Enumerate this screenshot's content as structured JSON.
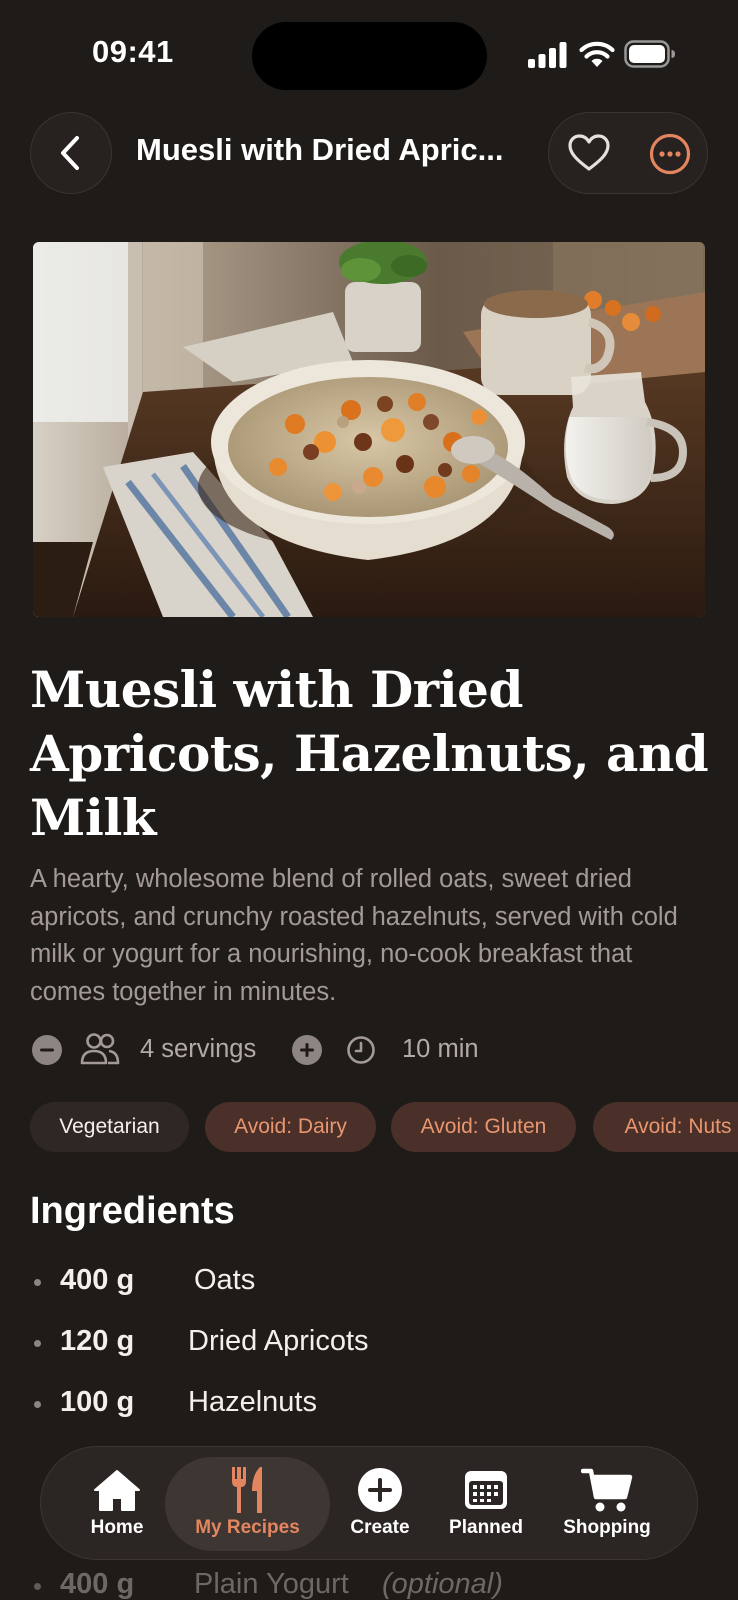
{
  "status_bar": {
    "time": "09:41"
  },
  "header": {
    "title": "Muesli with Dried Apric..."
  },
  "recipe": {
    "title": "Muesli with Dried Apricots, Hazelnuts, and Milk",
    "description": "A hearty, wholesome blend of rolled oats, sweet dried apricots, and crunchy roasted hazelnuts, served with cold milk or yogurt for a nourishing, no-cook breakfast that comes together in minutes.",
    "servings": "4 servings",
    "time": "10 min"
  },
  "tags": [
    {
      "label": "Vegetarian",
      "kind": "neutral"
    },
    {
      "label": "Avoid: Dairy",
      "kind": "avoid"
    },
    {
      "label": "Avoid: Gluten",
      "kind": "avoid"
    },
    {
      "label": "Avoid: Nuts",
      "kind": "avoid"
    }
  ],
  "ingredients_heading": "Ingredients",
  "ingredients": [
    {
      "qty": "400 g",
      "name": "Oats"
    },
    {
      "qty": "120 g",
      "name": "Dried Apricots"
    },
    {
      "qty": "100 g",
      "name": "Hazelnuts"
    },
    {
      "qty": "400 g",
      "name": "Plain Yogurt",
      "note": "(optional)"
    }
  ],
  "tab_bar": {
    "items": [
      {
        "label": "Home",
        "icon": "house-icon"
      },
      {
        "label": "My Recipes",
        "icon": "fork-knife-icon",
        "active": true
      },
      {
        "label": "Create",
        "icon": "plus-circle-icon"
      },
      {
        "label": "Planned",
        "icon": "calendar-icon"
      },
      {
        "label": "Shopping",
        "icon": "cart-icon"
      }
    ]
  },
  "colors": {
    "background": "#1f1b19",
    "accent": "#e3865f",
    "avoid_tag_bg": "#4a3028",
    "avoid_tag_text": "#e89670",
    "muted_text": "#a39a95"
  }
}
